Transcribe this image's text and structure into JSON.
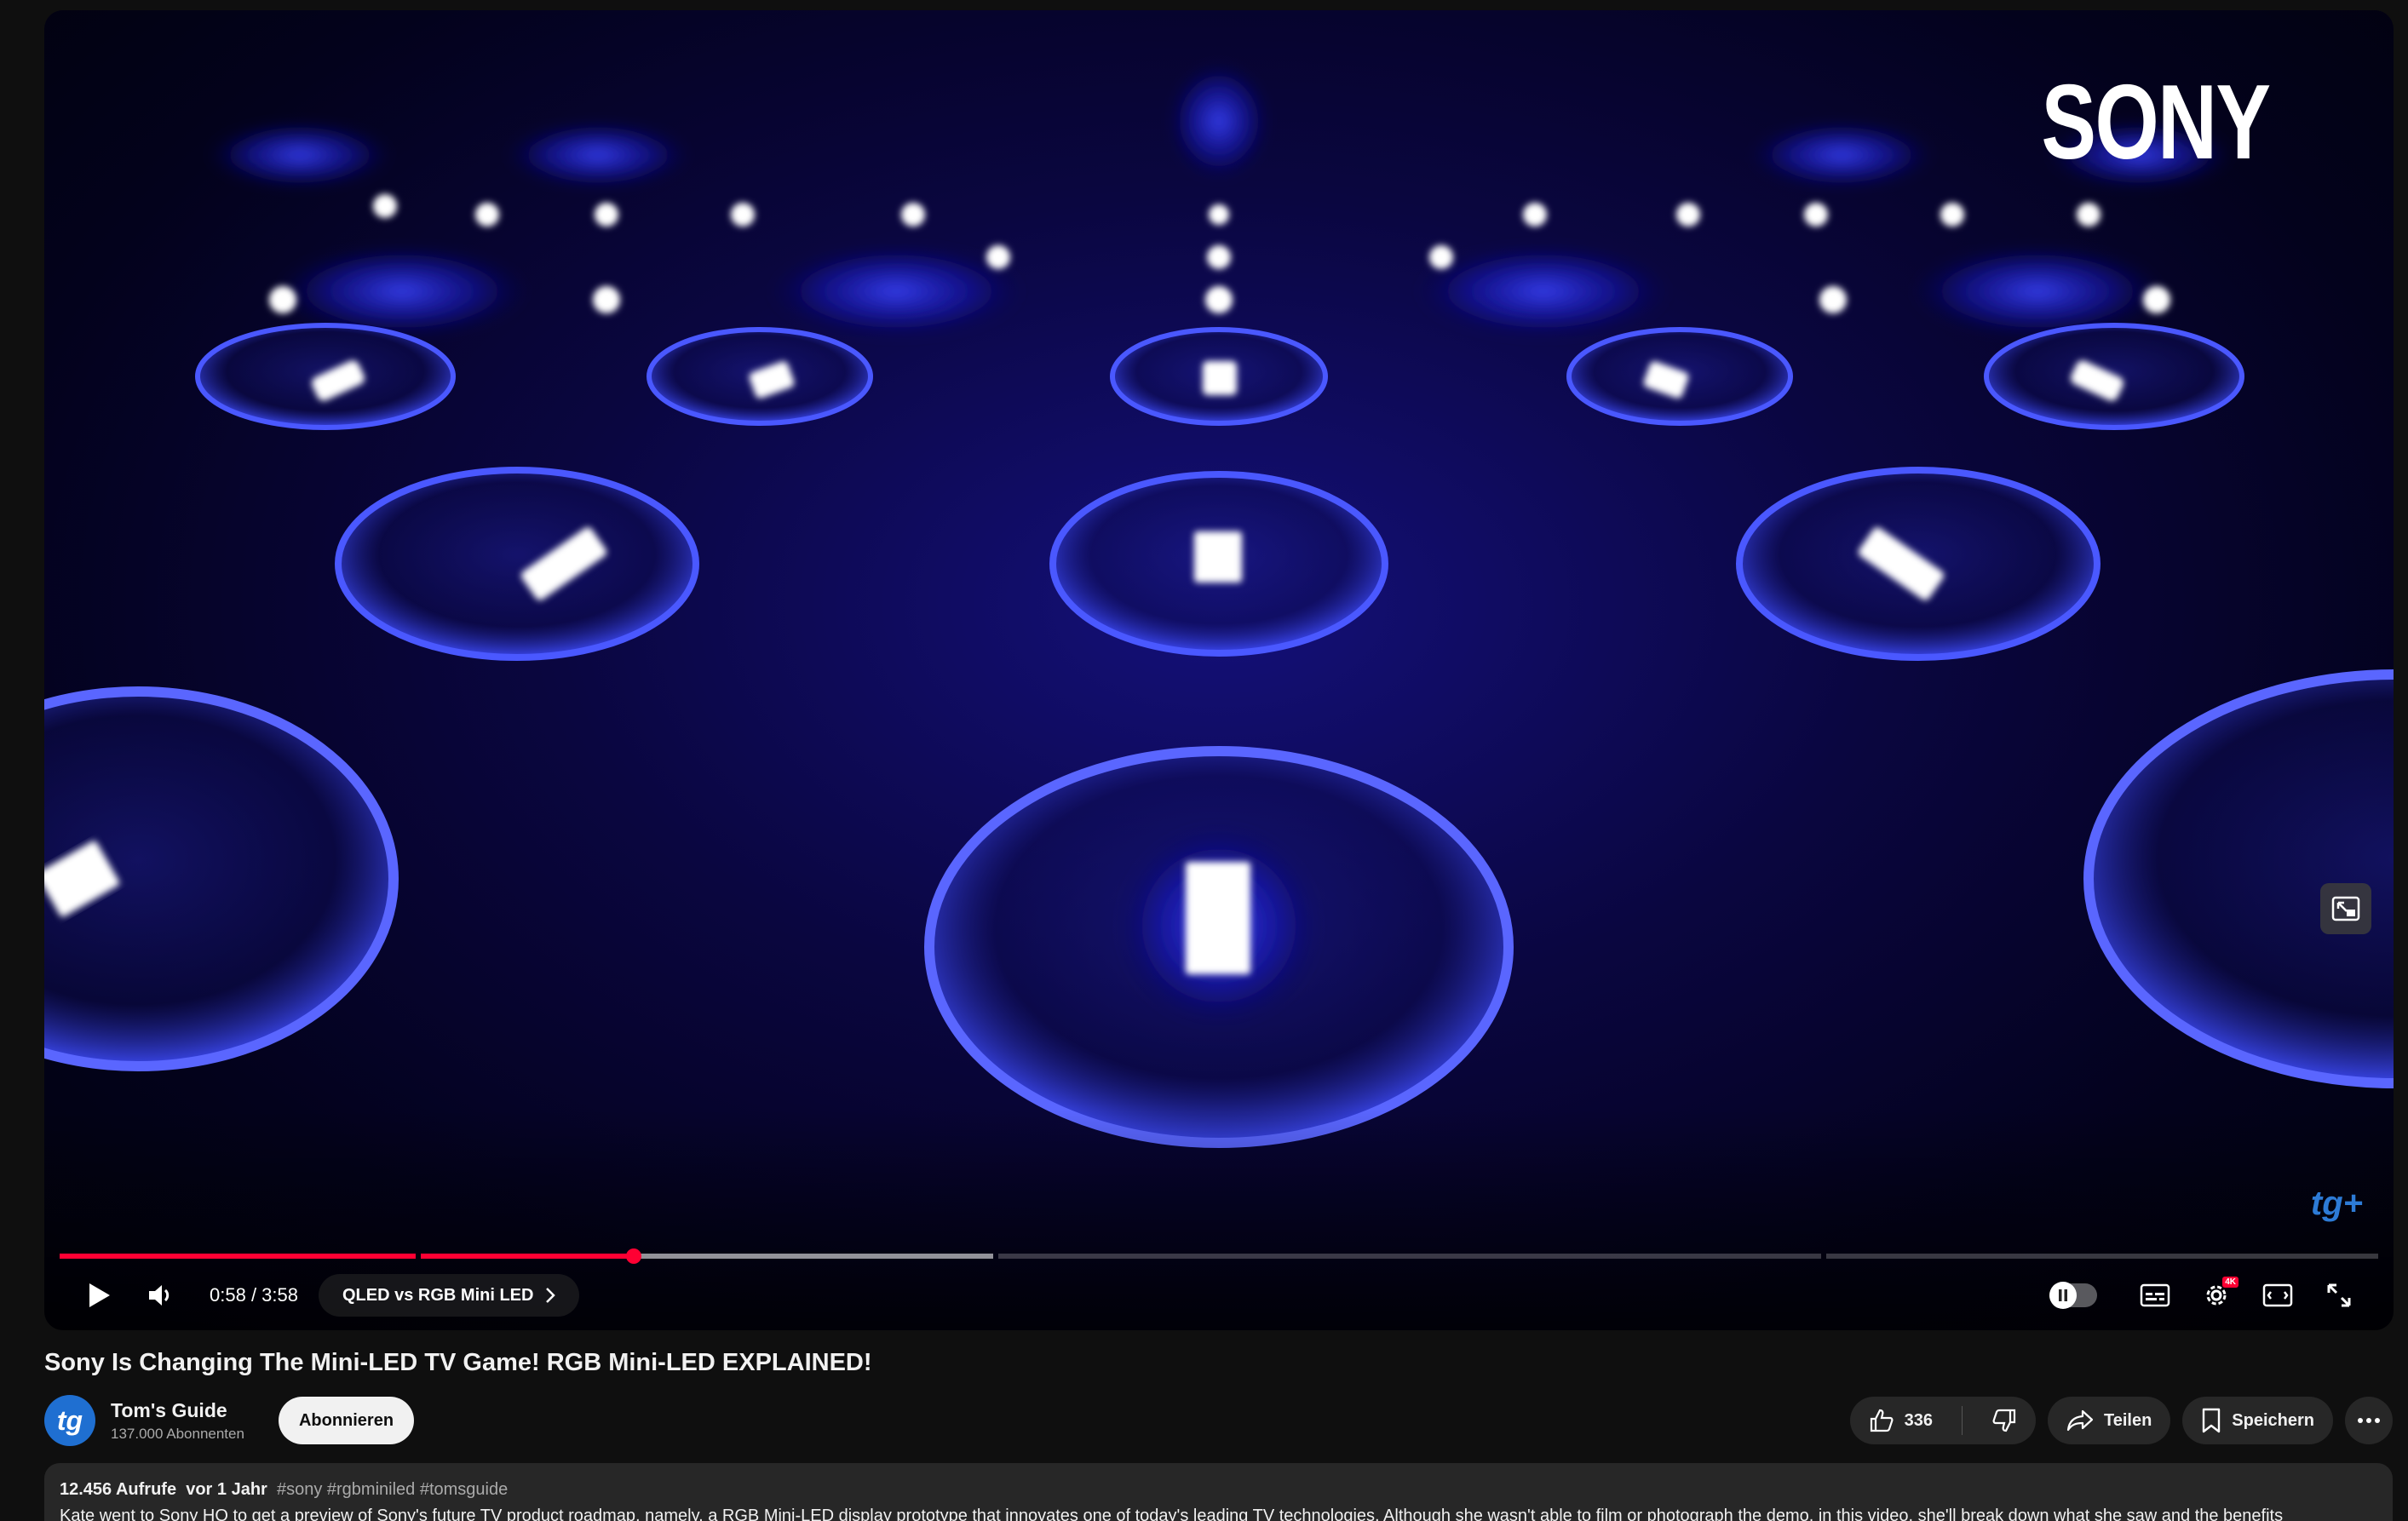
{
  "player": {
    "brand_logo": "SONY",
    "watermark": "tg+",
    "current_time": "0:58",
    "duration": "3:58",
    "time_separator": " / ",
    "progress_fraction": 0.244,
    "buffered_fraction": 0.35,
    "chapter_label": "QLED vs RGB Mini LED",
    "hd_badge": "4K",
    "accent_color": "#ff0033"
  },
  "video": {
    "title": "Sony Is Changing The Mini-LED TV Game! RGB Mini-LED EXPLAINED!"
  },
  "channel": {
    "avatar_text": "tg",
    "name": "Tom's Guide",
    "subscribers": "137.000 Abonnenten",
    "subscribe_label": "Abonnieren"
  },
  "actions": {
    "like_count": "336",
    "share_label": "Teilen",
    "save_label": "Speichern"
  },
  "description": {
    "views": "12.456 Aufrufe",
    "age": "vor 1 Jahr",
    "tags": "#sony #rgbminiled #tomsguide",
    "text": "Kate went to Sony HQ to get a preview of Sony's future TV product roadmap, namely, a RGB Mini-LED display prototype that innovates one of today's leading TV technologies. Although she wasn't able to film or photograph the demo, in this video, she'll break down what she saw and the benefits"
  }
}
